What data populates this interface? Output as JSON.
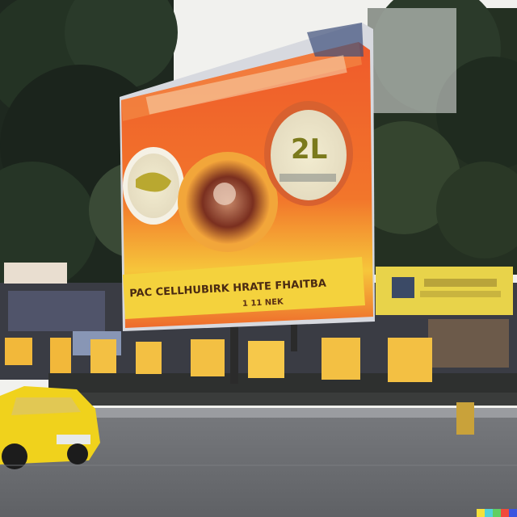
{
  "scene": {
    "description_label": "",
    "billboard": {
      "headline": "",
      "tagline": "PAC CELLHUBIRK HRATE FHAITBA",
      "subline": "1 11 NEK",
      "bowl_left_label": "",
      "bowl_right_label": "2L"
    },
    "side_sign_left": "",
    "side_sign_right": ""
  },
  "colors": {
    "sky": "#f2f2ef",
    "trees_dark": "#1f2a20",
    "billboard_red": "#e8472a",
    "billboard_orange": "#f27a2b",
    "billboard_yellow": "#f6d13a",
    "road": "#6d6f73",
    "taxi_yellow": "#f0d21c",
    "barrier_yellow": "#f3c043"
  }
}
